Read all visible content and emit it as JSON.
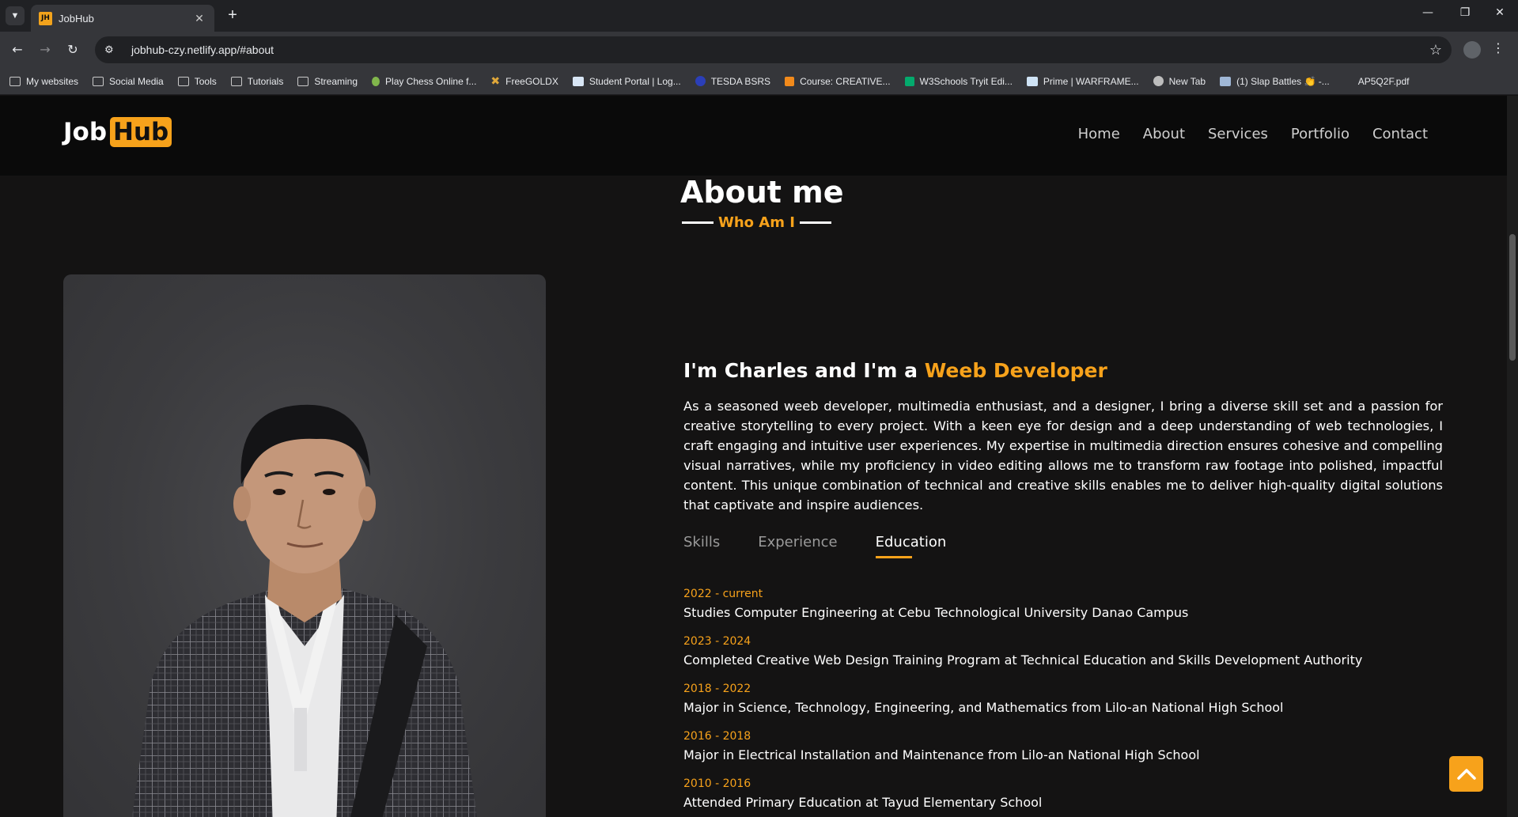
{
  "browser": {
    "tab_title": "JobHub",
    "tab_favicon": "JH",
    "url": "jobhub-czy.netlify.app/#about",
    "bookmarks": [
      {
        "label": "My websites",
        "icon": "folder-icon"
      },
      {
        "label": "Social Media",
        "icon": "folder-icon"
      },
      {
        "label": "Tools",
        "icon": "folder-icon"
      },
      {
        "label": "Tutorials",
        "icon": "folder-icon"
      },
      {
        "label": "Streaming",
        "icon": "folder-icon"
      },
      {
        "label": "Play Chess Online f...",
        "icon": "chess-pawn-icon"
      },
      {
        "label": "FreeGOLDX",
        "icon": "x-logo-icon"
      },
      {
        "label": "Student Portal | Log...",
        "icon": "document-icon"
      },
      {
        "label": "TESDA BSRS",
        "icon": "tesda-icon"
      },
      {
        "label": "Course: CREATIVE...",
        "icon": "course-icon"
      },
      {
        "label": "W3Schools Tryit Edi...",
        "icon": "w3schools-icon"
      },
      {
        "label": "Prime | WARFRAME...",
        "icon": "warframe-icon"
      },
      {
        "label": "New Tab",
        "icon": "globe-icon"
      },
      {
        "label": "(1) Slap Battles 👏 -...",
        "icon": "roblox-icon"
      },
      {
        "label": "AP5Q2F.pdf",
        "icon": "pdf-icon"
      }
    ]
  },
  "site": {
    "logo_job": "Job",
    "logo_hub": "Hub",
    "nav": [
      "Home",
      "About",
      "Services",
      "Portfolio",
      "Contact"
    ]
  },
  "about": {
    "title": "About me",
    "subtitle": "Who Am I",
    "intro_prefix": "I'm Charles and I'm a ",
    "intro_role": "Weeb Developer",
    "description": "As a seasoned weeb developer, multimedia enthusiast, and a designer, I bring a diverse skill set and a passion for creative storytelling to every project. With a keen eye for design and a deep understanding of web technologies, I craft engaging and intuitive user experiences. My expertise in multimedia direction ensures cohesive and compelling visual narratives, while my proficiency in video editing allows me to transform raw footage into polished, impactful content. This unique combination of technical and creative skills enables me to deliver high-quality digital solutions that captivate and inspire audiences.",
    "tabs": [
      {
        "label": "Skills",
        "active": false
      },
      {
        "label": "Experience",
        "active": false
      },
      {
        "label": "Education",
        "active": true
      }
    ],
    "education": [
      {
        "year": "2022 - current",
        "desc": "Studies Computer Engineering at Cebu Technological University Danao Campus"
      },
      {
        "year": "2023 - 2024",
        "desc": "Completed Creative Web Design Training Program at Technical Education and Skills Development Authority"
      },
      {
        "year": "2018 - 2022",
        "desc": "Major in Science, Technology, Engineering, and Mathematics from Lilo-an National High School"
      },
      {
        "year": "2016 - 2018",
        "desc": "Major in Electrical Installation and Maintenance from Lilo-an National High School"
      },
      {
        "year": "2010 - 2016",
        "desc": "Attended Primary Education at Tayud Elementary School"
      }
    ]
  },
  "colors": {
    "accent": "#f7a21b",
    "page_bg": "#141313",
    "header_bg": "#0a0a0a"
  }
}
